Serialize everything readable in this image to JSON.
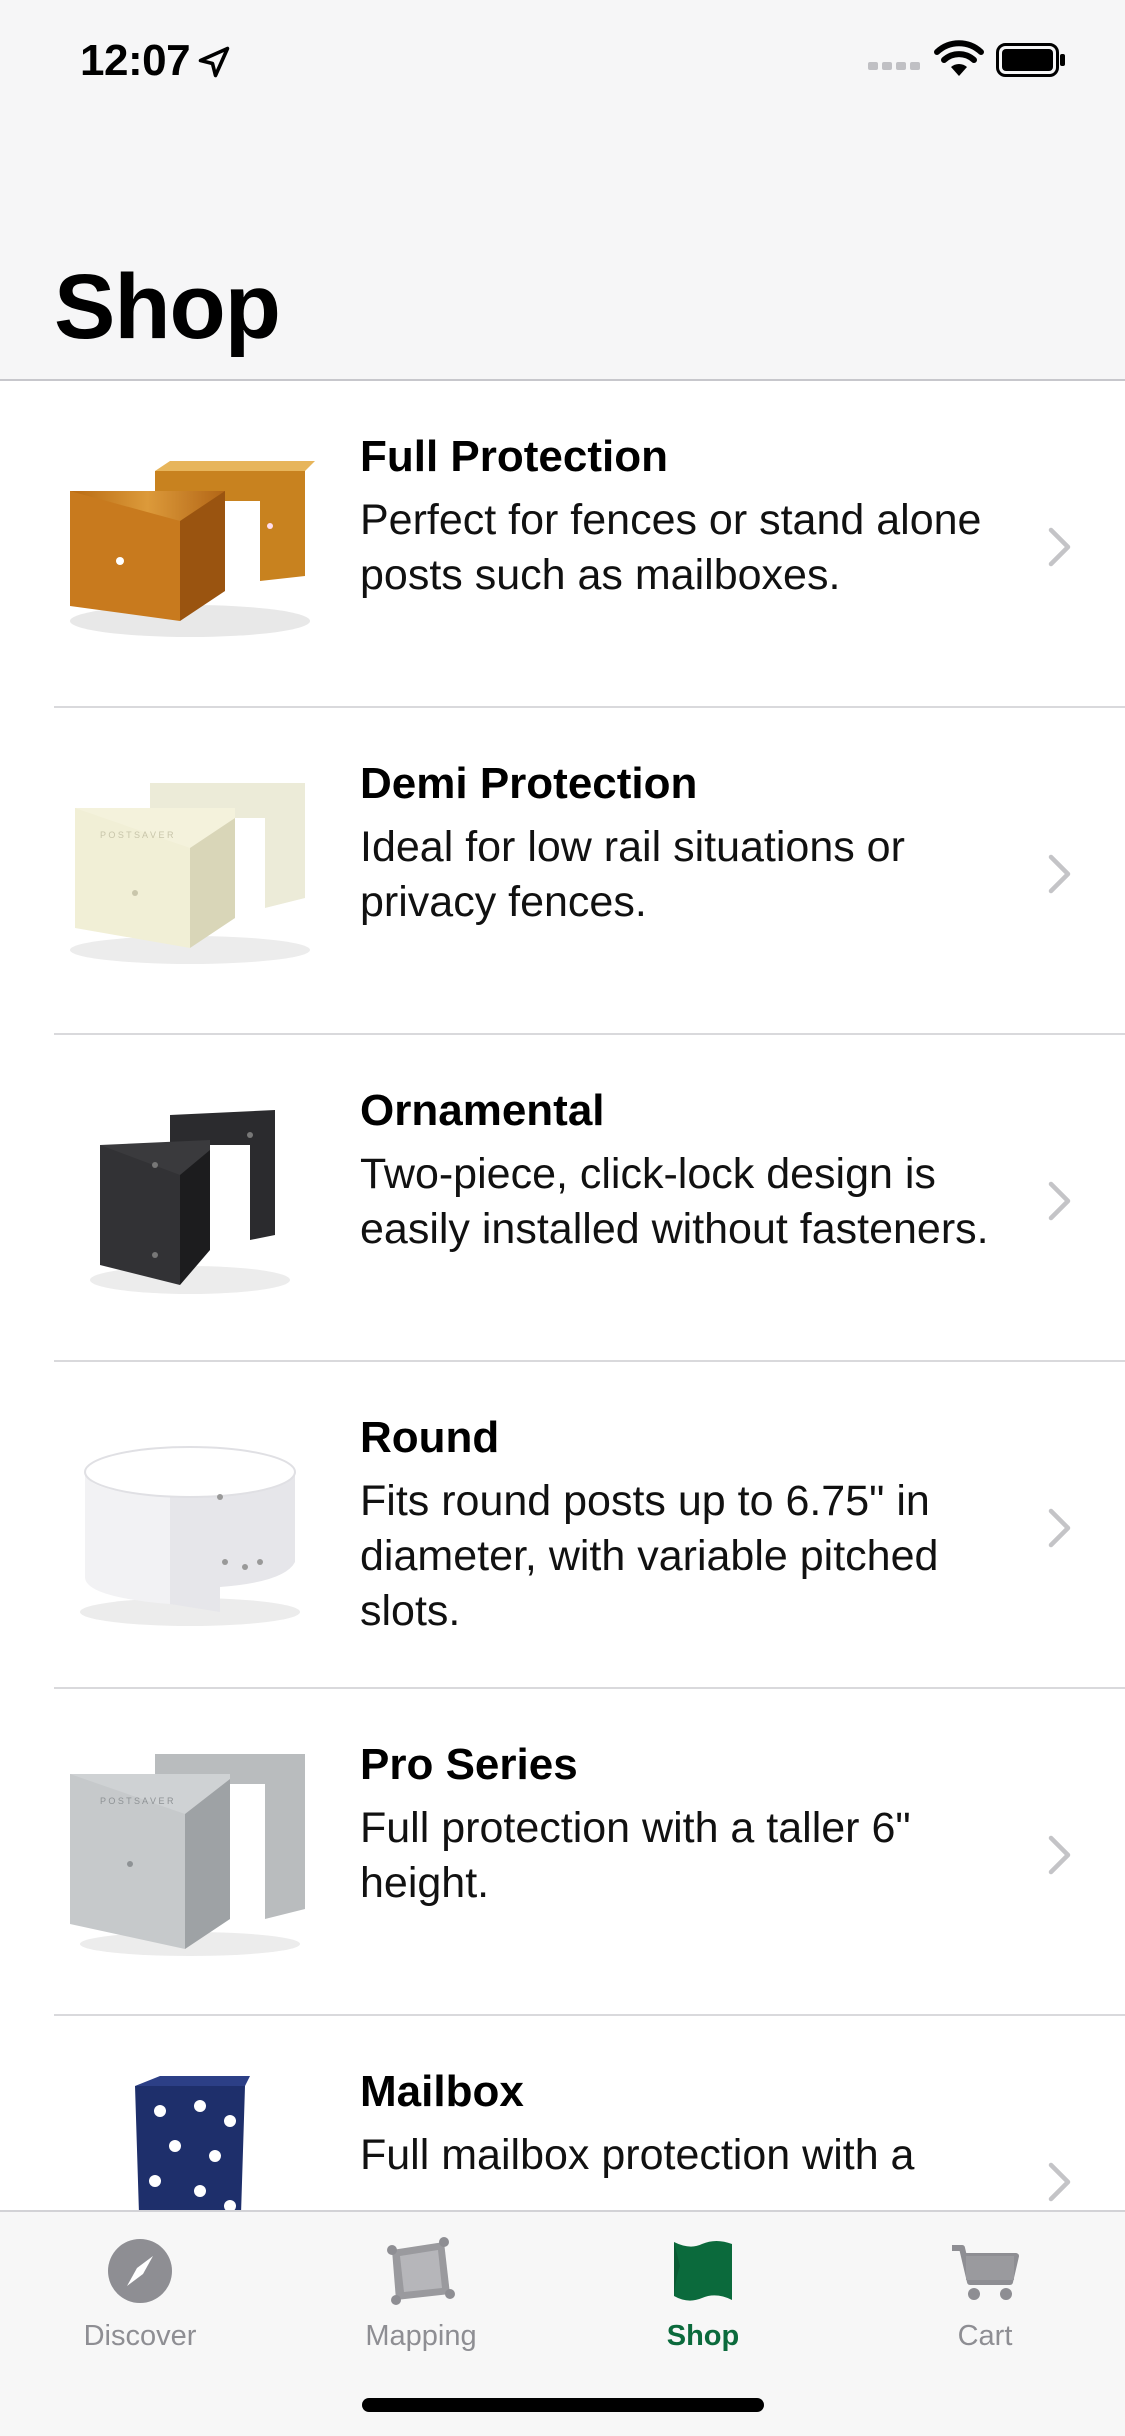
{
  "status_bar": {
    "time": "12:07"
  },
  "header": {
    "title": "Shop"
  },
  "items": [
    {
      "title": "Full Protection",
      "desc": "Perfect for fences or stand alone posts such as mailboxes."
    },
    {
      "title": "Demi Protection",
      "desc": "Ideal for low rail situations or privacy fences."
    },
    {
      "title": "Ornamental",
      "desc": "Two-piece, click-lock design is easily installed without fasteners."
    },
    {
      "title": "Round",
      "desc": "Fits round posts up to 6.75\" in diameter, with variable pitched slots."
    },
    {
      "title": "Pro Series",
      "desc": "Full protection with a taller 6\" height."
    },
    {
      "title": "Mailbox",
      "desc": "Full mailbox protection with a"
    }
  ],
  "tabs": [
    {
      "label": "Discover",
      "icon": "compass-icon"
    },
    {
      "label": "Mapping",
      "icon": "map-icon"
    },
    {
      "label": "Shop",
      "icon": "shop-icon"
    },
    {
      "label": "Cart",
      "icon": "cart-icon"
    }
  ],
  "colors": {
    "accent": "#0b6a3c",
    "inactive": "#8e8e93"
  }
}
